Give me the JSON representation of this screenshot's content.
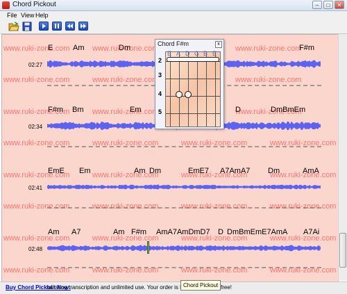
{
  "window": {
    "title": "Chord Pickout",
    "minimize": "–",
    "maximize": "□",
    "close": "✕"
  },
  "menu": [
    "File",
    "View",
    "Help"
  ],
  "toolbar": [
    "open-folder-icon",
    "save-icon",
    "play-icon",
    "pause-icon",
    "rewind-icon",
    "fast-forward-icon"
  ],
  "watermark": "www.ruki-zone.com",
  "tracks": [
    {
      "time": "02:27",
      "chords": [
        "E",
        "Am",
        "Dm",
        "F#m"
      ]
    },
    {
      "time": "02:34",
      "chords": [
        "F#m",
        "Bm",
        "Em",
        "D",
        "DmBmEm"
      ]
    },
    {
      "time": "02:41",
      "chords": [
        "EmE",
        "Em",
        "Am",
        "Dm",
        "EmE7",
        "A7AmA7",
        "Dm",
        "AmA"
      ]
    },
    {
      "time": "02:48",
      "chords": [
        "Am",
        "A7",
        "Am",
        "F#m",
        "AmA7AmDmD7",
        "D",
        "DmBmEmE7AmA",
        "A7Ai"
      ]
    }
  ],
  "chord_panel": {
    "title": "Chord F#m",
    "close": "x",
    "strings": [
      "E",
      "A",
      "D",
      "G",
      "B",
      "E"
    ],
    "frets": [
      "2",
      "3",
      "4",
      "5"
    ]
  },
  "status": {
    "link": "Buy Chord Pickout Now:",
    "text": " full song transcription and unlimited use. Your order is f",
    "text_end": " free!",
    "tooltip": "Chord Pickout"
  }
}
